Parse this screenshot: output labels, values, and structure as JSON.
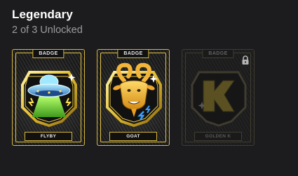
{
  "section": {
    "title": "Legendary",
    "progress_text": "2 of 3 Unlocked"
  },
  "badges": [
    {
      "tag": "BADGE",
      "name": "FLYBY",
      "locked": false,
      "icon": "ufo-icon"
    },
    {
      "tag": "BADGE",
      "name": "GOAT",
      "locked": false,
      "icon": "goat-icon"
    },
    {
      "tag": "BADGE",
      "name": "GOLDEN K",
      "locked": true,
      "icon": "golden-k-icon"
    }
  ],
  "colors": {
    "background": "#1c1c1e",
    "gold": "#d7b63a",
    "text_primary": "#ffffff",
    "text_secondary": "#9b9b9f"
  }
}
